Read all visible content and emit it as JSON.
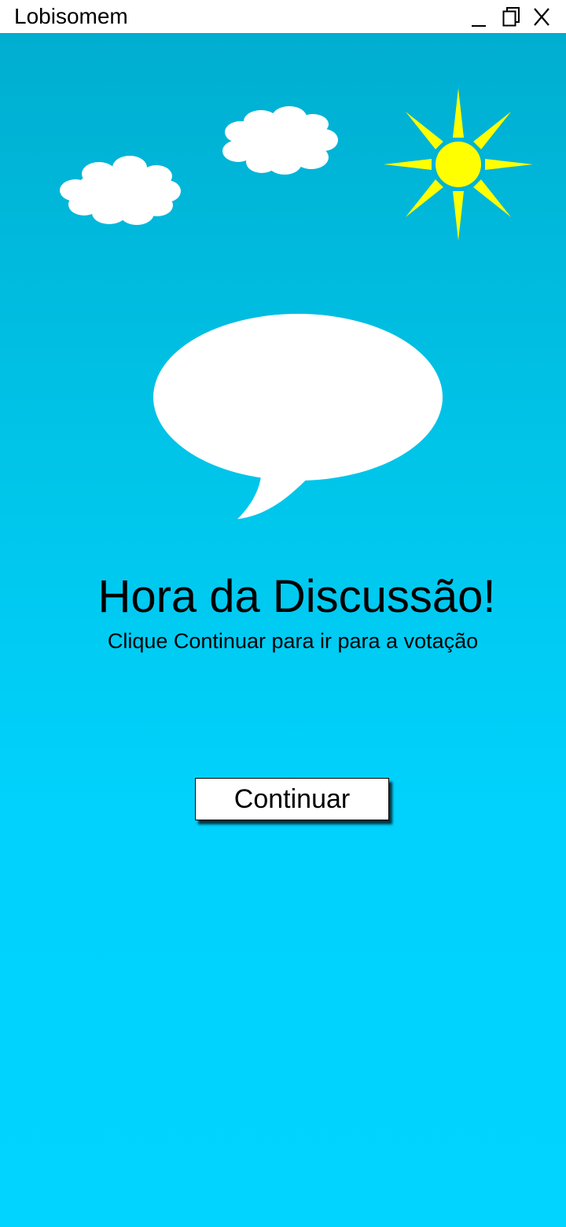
{
  "window": {
    "title": "Lobisomem",
    "controls": {
      "minimize_icon": "minimize-icon",
      "restore_icon": "restore-icon",
      "close_icon": "close-icon"
    }
  },
  "scene": {
    "background_top": "#00aed0",
    "background_bottom": "#00d4ff",
    "sun_color": "#ffff00",
    "cloud_color": "#ffffff",
    "bubble_color": "#ffffff"
  },
  "main": {
    "heading": "Hora da Discussão!",
    "subheading": "Clique Continuar para ir para a votação",
    "continue_label": "Continuar"
  }
}
